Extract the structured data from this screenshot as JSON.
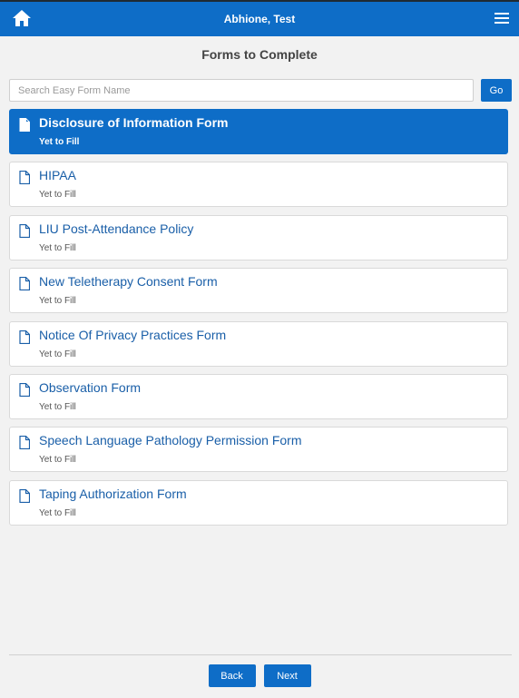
{
  "header": {
    "user_name": "Abhione, Test",
    "home_icon": "home-icon",
    "menu_icon": "hamburger-menu-icon",
    "bar_color": "#0e6dc7"
  },
  "page": {
    "title": "Forms to Complete"
  },
  "search": {
    "placeholder": "Search Easy Form Name",
    "value": "",
    "go_label": "Go"
  },
  "forms": [
    {
      "name": "Disclosure of Information Form",
      "status": "Yet to Fill",
      "selected": true
    },
    {
      "name": "HIPAA",
      "status": "Yet to Fill",
      "selected": false
    },
    {
      "name": "LIU Post-Attendance Policy",
      "status": "Yet to Fill",
      "selected": false
    },
    {
      "name": "New Teletherapy Consent Form",
      "status": "Yet to Fill",
      "selected": false
    },
    {
      "name": "Notice Of Privacy Practices Form",
      "status": "Yet to Fill",
      "selected": false
    },
    {
      "name": "Observation Form",
      "status": "Yet to Fill",
      "selected": false
    },
    {
      "name": "Speech Language Pathology Permission Form",
      "status": "Yet to Fill",
      "selected": false
    },
    {
      "name": "Taping Authorization Form",
      "status": "Yet to Fill",
      "selected": false
    }
  ],
  "footer": {
    "back_label": "Back",
    "next_label": "Next"
  }
}
